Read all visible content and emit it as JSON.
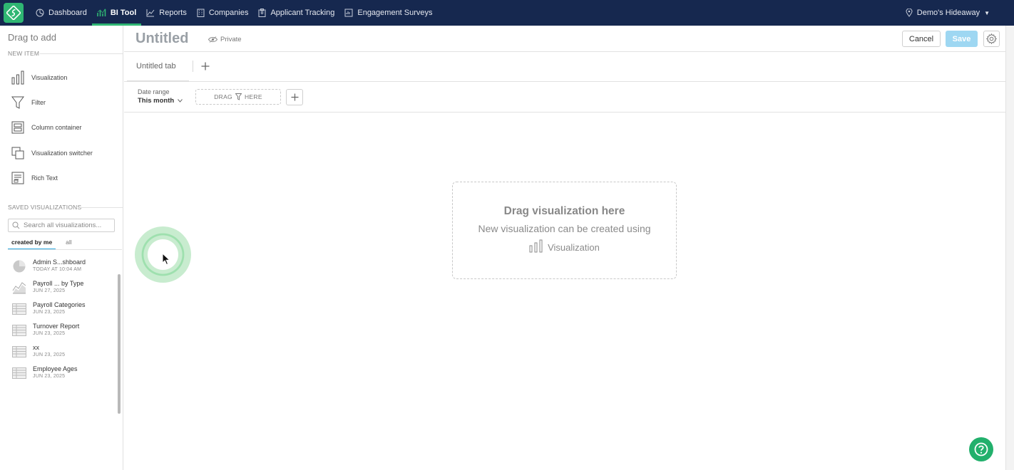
{
  "nav": {
    "items": [
      {
        "label": "Dashboard",
        "icon": "dashboard-icon"
      },
      {
        "label": "BI Tool",
        "icon": "bar-chart-icon",
        "active": true
      },
      {
        "label": "Reports",
        "icon": "line-chart-icon"
      },
      {
        "label": "Companies",
        "icon": "building-icon"
      },
      {
        "label": "Applicant Tracking",
        "icon": "clipboard-icon"
      },
      {
        "label": "Engagement Surveys",
        "icon": "survey-icon"
      }
    ],
    "company": "Demo's Hideaway"
  },
  "sidebar": {
    "title": "Drag to add",
    "new_item_label": "NEW ITEM",
    "new_items": [
      {
        "label": "Visualization",
        "icon": "bar-chart-icon"
      },
      {
        "label": "Filter",
        "icon": "funnel-icon"
      },
      {
        "label": "Column container",
        "icon": "column-container-icon"
      },
      {
        "label": "Visualization switcher",
        "icon": "switcher-icon"
      },
      {
        "label": "Rich Text",
        "icon": "rich-text-icon"
      }
    ],
    "saved_label": "SAVED VISUALIZATIONS",
    "search_placeholder": "Search all visualizations...",
    "tabs": {
      "created": "created by me",
      "all": "all"
    },
    "saved": [
      {
        "name": "Admin S...shboard",
        "date": "TODAY AT 10:04 AM",
        "icon": "pie-chart-icon"
      },
      {
        "name": "Payroll ... by Type",
        "date": "JUN 27, 2025",
        "icon": "area-chart-icon"
      },
      {
        "name": "Payroll Categories",
        "date": "JUN 23, 2025",
        "icon": "table-icon"
      },
      {
        "name": "Turnover Report",
        "date": "JUN 23, 2025",
        "icon": "table-icon"
      },
      {
        "name": "xx",
        "date": "JUN 23, 2025",
        "icon": "table-icon"
      },
      {
        "name": "Employee Ages",
        "date": "JUN 23, 2025",
        "icon": "table-icon"
      }
    ]
  },
  "header": {
    "title": "Untitled",
    "privacy": "Private",
    "cancel": "Cancel",
    "save": "Save"
  },
  "tabs": {
    "current": "Untitled tab"
  },
  "filters": {
    "date_label": "Date range",
    "date_value": "This month",
    "drag_left": "DRAG",
    "drag_right": "HERE"
  },
  "dropzone": {
    "title": "Drag visualization here",
    "subtitle": "New visualization can be created using",
    "viz_label": "Visualization"
  },
  "colors": {
    "nav_bg": "#16284f",
    "brand": "#2fb673",
    "save_btn": "#9ed7f2",
    "tab_underline": "#2aa6de"
  }
}
